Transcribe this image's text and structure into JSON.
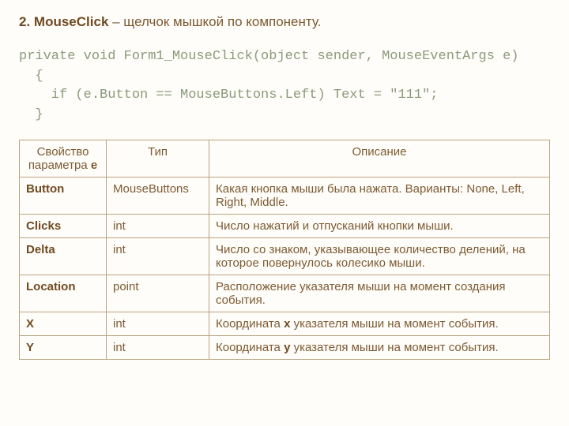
{
  "heading": {
    "number": "2.",
    "name": "MouseClick",
    "desc": " – щелчок мышкой по компоненту."
  },
  "code": {
    "l1": "private void Form1_MouseClick(object sender, MouseEventArgs e)",
    "l2": "  {",
    "l3": "    if (e.Button == MouseButtons.Left) Text = \"111\";",
    "l4": "  }"
  },
  "table": {
    "headers": {
      "h1a": "Свойство",
      "h1b": "параметра ",
      "h1e": "e",
      "h2": "Тип",
      "h3": "Описание"
    },
    "rows": [
      {
        "prop": "Button",
        "type": "MouseButtons",
        "desc": "Какая кнопка мыши была нажата. Варианты: None, Left, Right, Middle."
      },
      {
        "prop": "Clicks",
        "type": "int",
        "desc": "Число нажатий и отпусканий кнопки мыши."
      },
      {
        "prop": "Delta",
        "type": "int",
        "desc": "Число со знаком, указывающее количество делений, на которое повернулось колесико мыши."
      },
      {
        "prop": "Location",
        "type": "point",
        "desc": "Расположение указателя мыши на момент создания события."
      },
      {
        "prop": "X",
        "type": "int",
        "desc_pre": "Координата ",
        "desc_b": "x",
        "desc_post": " указателя мыши на момент события."
      },
      {
        "prop": "Y",
        "type": "int",
        "desc_pre": "Координата ",
        "desc_b": "y",
        "desc_post": " указателя мыши на момент события."
      }
    ]
  }
}
